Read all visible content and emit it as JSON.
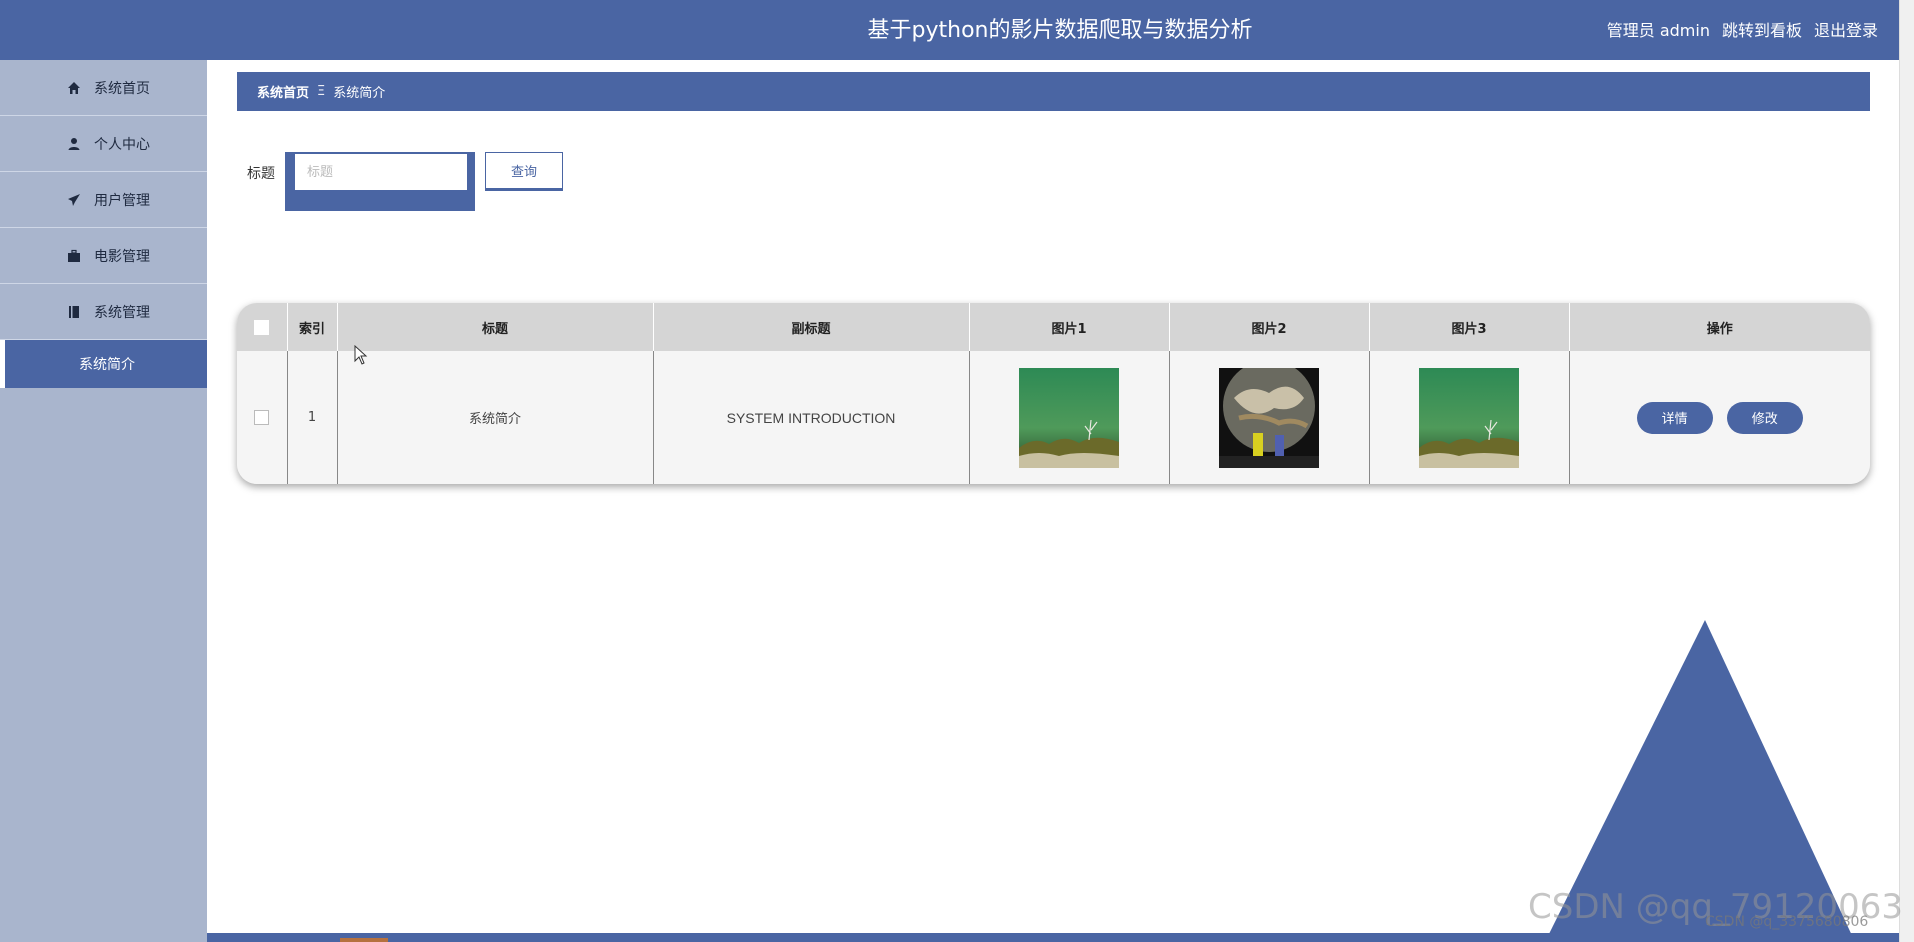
{
  "header": {
    "title": "基于python的影片数据爬取与数据分析",
    "user": "管理员 admin",
    "dashboard_link": "跳转到看板",
    "logout": "退出登录"
  },
  "sidebar": {
    "items": [
      {
        "label": "系统首页",
        "icon": "home-icon"
      },
      {
        "label": "个人中心",
        "icon": "user-icon"
      },
      {
        "label": "用户管理",
        "icon": "paper-plane-icon"
      },
      {
        "label": "电影管理",
        "icon": "briefcase-icon"
      },
      {
        "label": "系统管理",
        "icon": "book-icon"
      }
    ],
    "active_sub": "系统简介"
  },
  "breadcrumb": {
    "home": "系统首页",
    "separator": "Ξ",
    "current": "系统简介"
  },
  "search": {
    "label": "标题",
    "placeholder": "标题",
    "value": "",
    "button": "查询"
  },
  "table": {
    "headers": [
      "索引",
      "标题",
      "副标题",
      "图片1",
      "图片2",
      "图片3",
      "操作"
    ],
    "rows": [
      {
        "index": "1",
        "title": "系统简介",
        "subtitle": "SYSTEM INTRODUCTION",
        "actions": [
          "详情",
          "修改"
        ]
      }
    ]
  },
  "watermark": {
    "main": "CSDN @qq_79120063",
    "secondary": "CSDN @q_3375680806"
  },
  "colors": {
    "primary": "#4a65a3",
    "sidebar": "#a9b5cd",
    "table_header": "#d5d5d5"
  }
}
